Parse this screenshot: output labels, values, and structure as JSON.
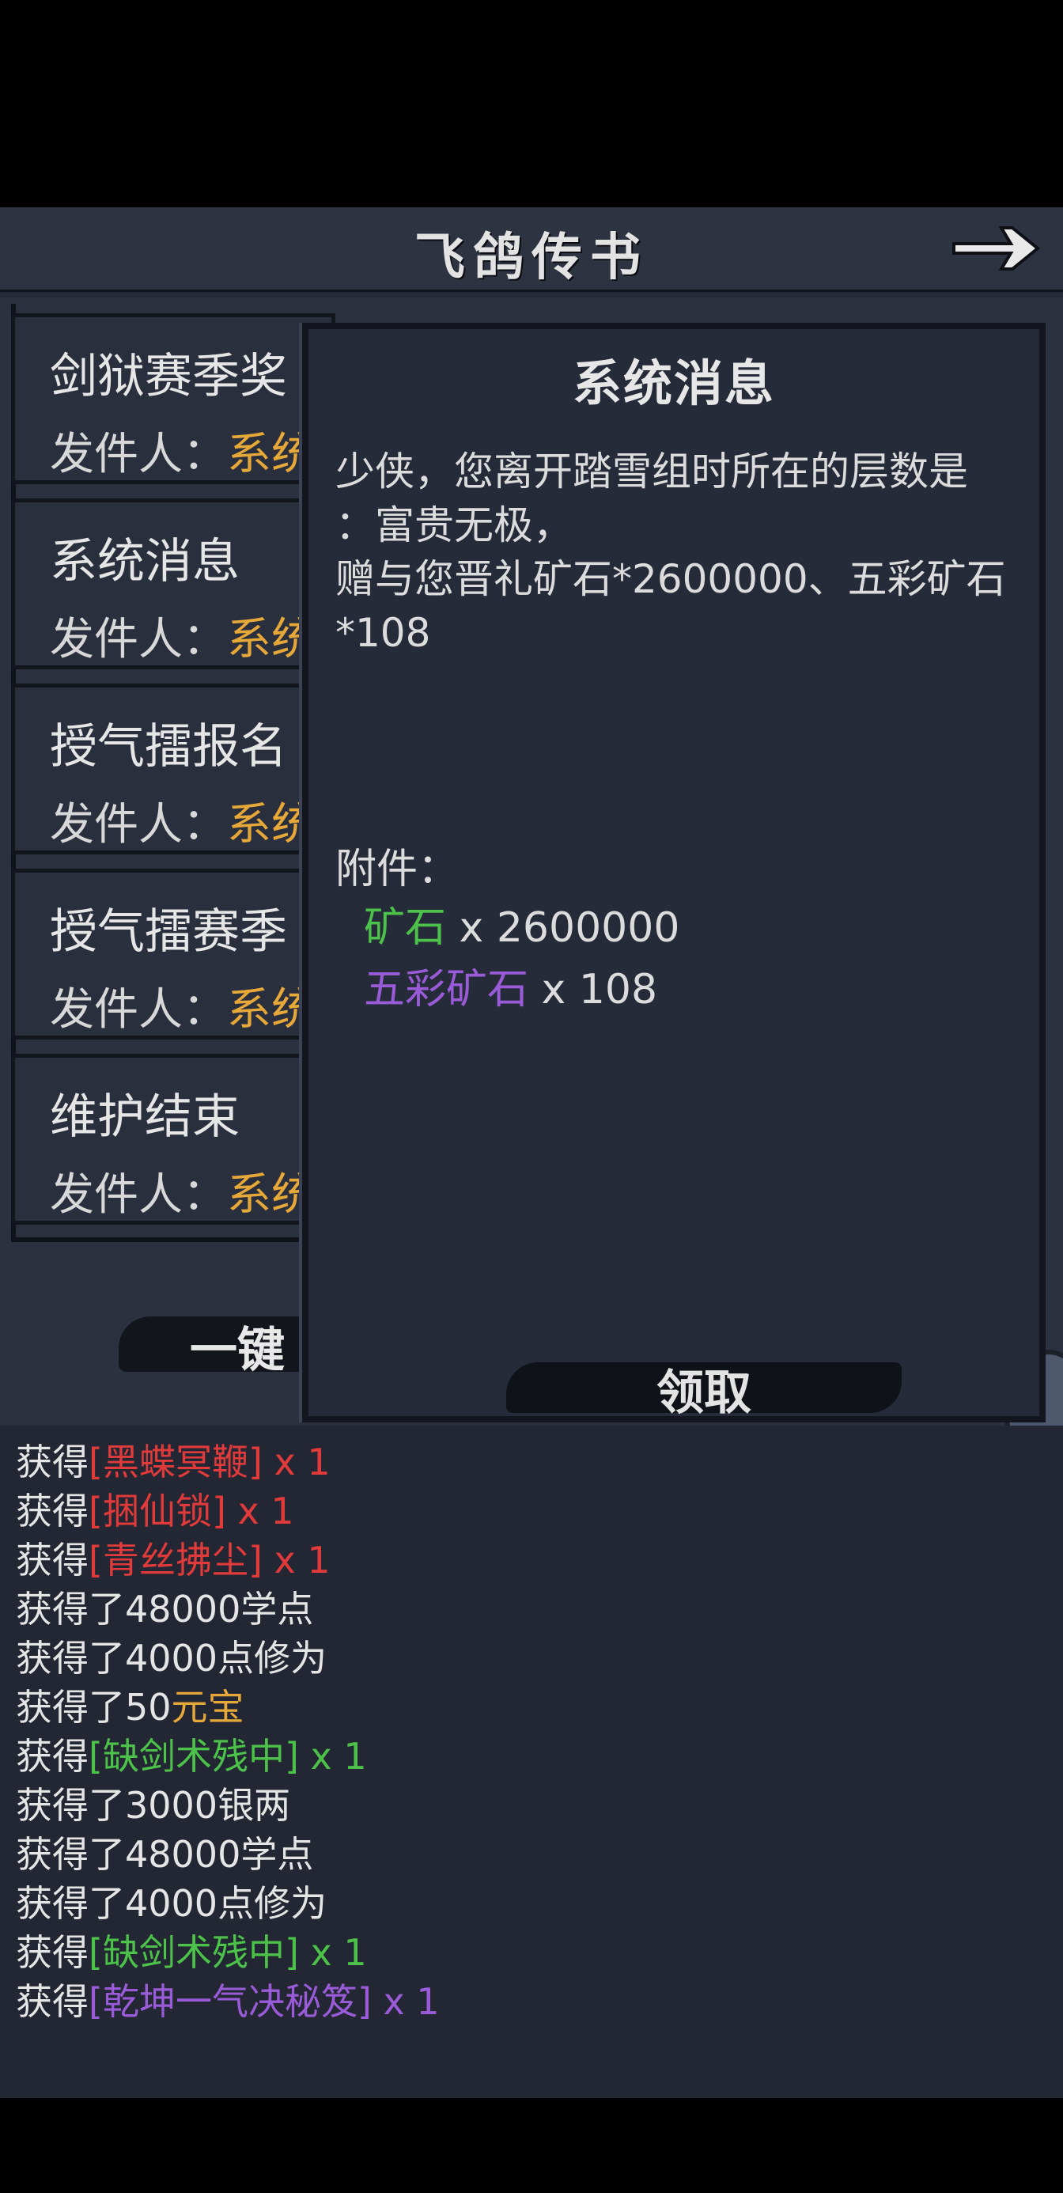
{
  "title": "飞鸽传书",
  "mail_list": [
    {
      "title": "剑狱赛季奖",
      "sender_label": "发件人：",
      "sender": "系统"
    },
    {
      "title": "系统消息",
      "sender_label": "发件人：",
      "sender": "系统"
    },
    {
      "title": "授气擂报名",
      "sender_label": "发件人：",
      "sender": "系统"
    },
    {
      "title": "授气擂赛季",
      "sender_label": "发件人：",
      "sender": "系统"
    },
    {
      "title": "维护结束",
      "sender_label": "发件人：",
      "sender": "系统"
    }
  ],
  "claim_all_label": "一键",
  "detail": {
    "title": "系统消息",
    "body": [
      "少侠，您离开踏雪组时所在的层数是",
      "：富贵无极，",
      "赠与您晋礼矿石*2600000、五彩矿石",
      "*108"
    ],
    "attachments_label": "附件：",
    "attachments": [
      {
        "name": "矿石",
        "qty": " x 2600000",
        "color": "#4cc24a"
      },
      {
        "name": "五彩矿石",
        "qty": " x 108",
        "color": "#9a5bd8"
      }
    ],
    "claim_label": "领取"
  },
  "log": [
    {
      "prefix": "获得",
      "item": "[黑蝶冥鞭]",
      "suffix": " x 1",
      "color": "#e03a3a"
    },
    {
      "prefix": "获得",
      "item": "[捆仙锁]",
      "suffix": " x 1",
      "color": "#e03a3a"
    },
    {
      "prefix": "获得",
      "item": "[青丝拂尘]",
      "suffix": " x 1",
      "color": "#e03a3a"
    },
    {
      "prefix": "获得了48000学点",
      "item": "",
      "suffix": "",
      "color": "#e5e5e5"
    },
    {
      "prefix": "获得了4000点修为",
      "item": "",
      "suffix": "",
      "color": "#e5e5e5"
    },
    {
      "prefix": "获得了50",
      "item": "元宝",
      "suffix": "",
      "color": "#e7a83a"
    },
    {
      "prefix": "获得",
      "item": "[缺剑术残中]",
      "suffix": " x 1",
      "color": "#4cc24a"
    },
    {
      "prefix": "获得了3000银两",
      "item": "",
      "suffix": "",
      "color": "#e5e5e5"
    },
    {
      "prefix": "获得了48000学点",
      "item": "",
      "suffix": "",
      "color": "#e5e5e5"
    },
    {
      "prefix": "获得了4000点修为",
      "item": "",
      "suffix": "",
      "color": "#e5e5e5"
    },
    {
      "prefix": "获得",
      "item": "[缺剑术残中]",
      "suffix": " x 1",
      "color": "#4cc24a"
    },
    {
      "prefix": "获得",
      "item": "[乾坤一气决秘笈]",
      "suffix": " x 1",
      "color": "#9a5bd8"
    }
  ],
  "icons": {
    "back": "right-arrow-icon",
    "scroll_up": "triangle-up-icon"
  }
}
